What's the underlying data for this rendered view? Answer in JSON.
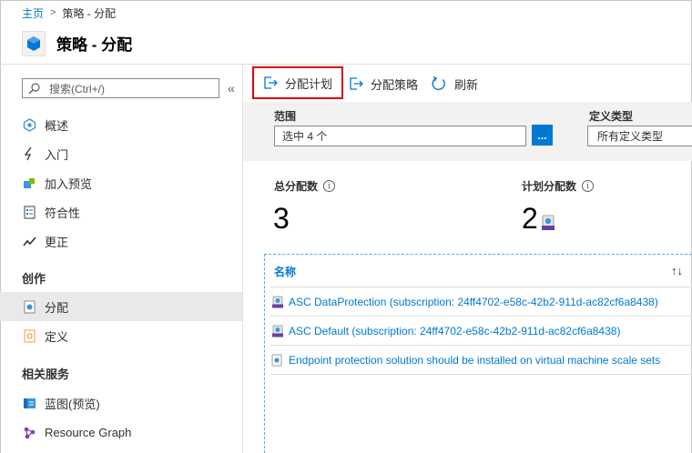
{
  "breadcrumb": {
    "home": "主页",
    "current": "策略 - 分配"
  },
  "page": {
    "title": "策略 - 分配"
  },
  "sidebar": {
    "search_placeholder": "搜索(Ctrl+/)",
    "collapse_icon": "«",
    "items": [
      {
        "label": "概述",
        "icon": "overview-icon"
      },
      {
        "label": "入门",
        "icon": "lightning-icon"
      },
      {
        "label": "加入预览",
        "icon": "preview-icon"
      },
      {
        "label": "符合性",
        "icon": "compliance-icon"
      },
      {
        "label": "更正",
        "icon": "remediation-icon"
      }
    ],
    "sections": [
      {
        "title": "创作",
        "items": [
          {
            "label": "分配",
            "icon": "assignment-icon",
            "active": true
          },
          {
            "label": "定义",
            "icon": "definition-icon"
          }
        ]
      },
      {
        "title": "相关服务",
        "items": [
          {
            "label": "蓝图(预览)",
            "icon": "blueprint-icon"
          },
          {
            "label": "Resource Graph",
            "icon": "resource-graph-icon"
          }
        ]
      }
    ]
  },
  "toolbar": {
    "assign_initiative": "分配计划",
    "assign_policy": "分配策略",
    "refresh": "刷新"
  },
  "filters": {
    "scope_label": "范围",
    "scope_value": "选中 4 个",
    "ellipsis": "...",
    "definition_type_label": "定义类型",
    "definition_type_value": "所有定义类型"
  },
  "stats": {
    "total_label": "总分配数",
    "total_value": "3",
    "initiative_label": "计划分配数",
    "initiative_value": "2",
    "info_glyph": "i"
  },
  "list": {
    "header": "名称",
    "sort_glyph": "↑↓",
    "rows": [
      {
        "name": "ASC DataProtection (subscription: 24ff4702-e58c-42b2-911d-ac82cf6a8438)",
        "icon": "initiative-icon"
      },
      {
        "name": "ASC Default (subscription: 24ff4702-e58c-42b2-911d-ac82cf6a8438)",
        "icon": "initiative-icon"
      },
      {
        "name": "Endpoint protection solution should be installed on virtual machine scale sets",
        "icon": "policy-icon"
      }
    ]
  },
  "colors": {
    "accent": "#0078d4",
    "highlight_border": "#e00000",
    "active_bg": "#e9e9e9",
    "filter_bg": "#f3f2f1"
  }
}
